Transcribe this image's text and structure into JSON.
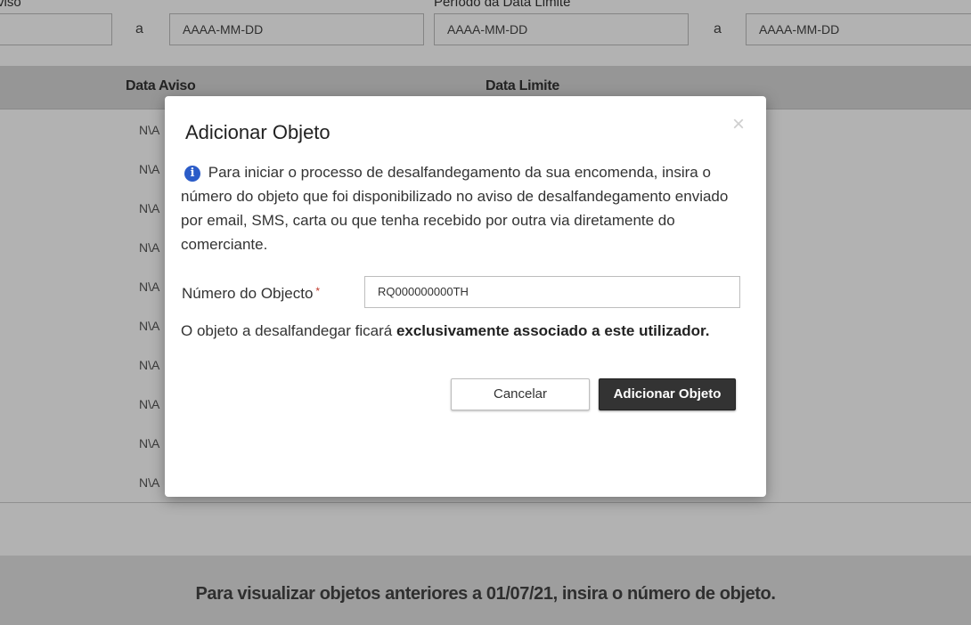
{
  "filters": {
    "aviso_label": "viso",
    "limite_label": "Período da Data Limite",
    "separator": "a",
    "date_placeholder": "AAAA-MM-DD"
  },
  "table": {
    "headers": {
      "data_aviso": "Data Aviso",
      "data_limite": "Data Limite"
    },
    "rows": [
      "N\\A",
      "N\\A",
      "N\\A",
      "N\\A",
      "N\\A",
      "N\\A",
      "N\\A",
      "N\\A",
      "N\\A",
      "N\\A"
    ]
  },
  "footer": {
    "text": "Para visualizar objetos anteriores a 01/07/21, insira o número de objeto."
  },
  "modal": {
    "title": "Adicionar Objeto",
    "close_glyph": "×",
    "info_glyph": "i",
    "intro": "Para iniciar o processo de desalfandegamento da sua encomenda, insira o número do objeto que foi disponibilizado no aviso de desalfandegamento enviado por email, SMS, carta ou que tenha recebido por outra via diretamente do comerciante.",
    "field_label": "Número do Objecto",
    "required_mark": "*",
    "input_value": "RQ000000000TH",
    "note_prefix": "O objeto a desalfandegar ficará ",
    "note_bold": "exclusivamente associado a este utilizador.",
    "cancel_label": "Cancelar",
    "add_label": "Adicionar Objeto"
  },
  "colors": {
    "info_icon": "#2b5cc8",
    "primary_button": "#333333",
    "required": "#c0392b"
  },
  "icons": {
    "close": "close-icon",
    "info": "info-icon"
  }
}
